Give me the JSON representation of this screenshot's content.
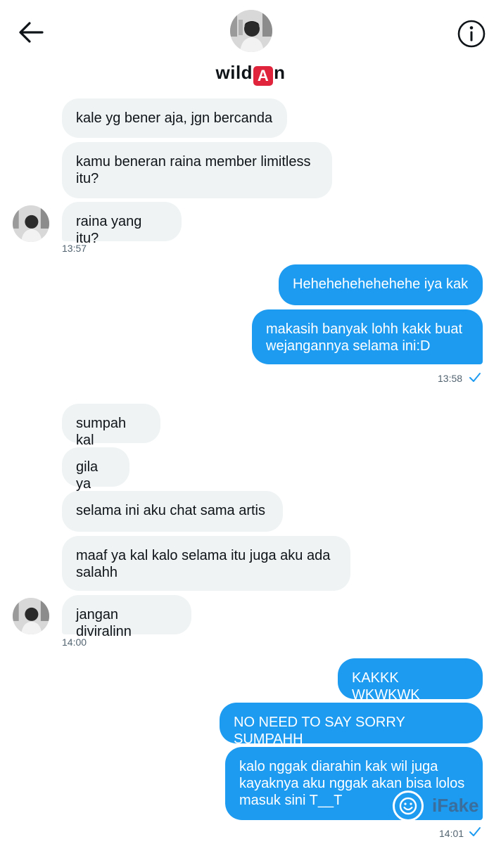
{
  "header": {
    "back_icon": "arrow-left-icon",
    "info_icon": "info-circle-icon",
    "name_prefix": "wild",
    "name_badge": "A",
    "name_suffix": "n"
  },
  "messages": [
    {
      "dir": "in",
      "text": "kale yg bener aja, jgn bercanda"
    },
    {
      "dir": "in",
      "text": "kamu beneran raina member limitless\nitu?"
    },
    {
      "dir": "in",
      "text": "raina yang itu?"
    },
    {
      "dir": "out",
      "text": "Hehehehehehehehe iya kak"
    },
    {
      "dir": "out",
      "text": "makasih banyak lohh kakk buat\nwejangannya selama ini:D"
    },
    {
      "dir": "in",
      "text": "sumpah kal"
    },
    {
      "dir": "in",
      "text": "gila ya"
    },
    {
      "dir": "in",
      "text": "selama ini aku chat sama artis"
    },
    {
      "dir": "in",
      "text": "maaf ya kal kalo selama itu juga aku ada\nsalahh"
    },
    {
      "dir": "in",
      "text": "jangan diviralinn"
    },
    {
      "dir": "out",
      "text": "KAKKK WKWKWK"
    },
    {
      "dir": "out",
      "text": "NO NEED TO SAY SORRY SUMPAHH"
    },
    {
      "dir": "out",
      "text": "kalo nggak diarahin kak wil juga\nkayaknya aku nggak akan bisa lolos\nmasuk sini T__T"
    }
  ],
  "timestamps": [
    "13:57",
    "13:58",
    "14:00",
    "14:01"
  ],
  "watermark": {
    "text": "iFake"
  },
  "colors": {
    "outgoing": "#1d9bf0",
    "incoming": "#eff3f4",
    "accent": "#1d9bf0",
    "badge": "#e0243b"
  }
}
